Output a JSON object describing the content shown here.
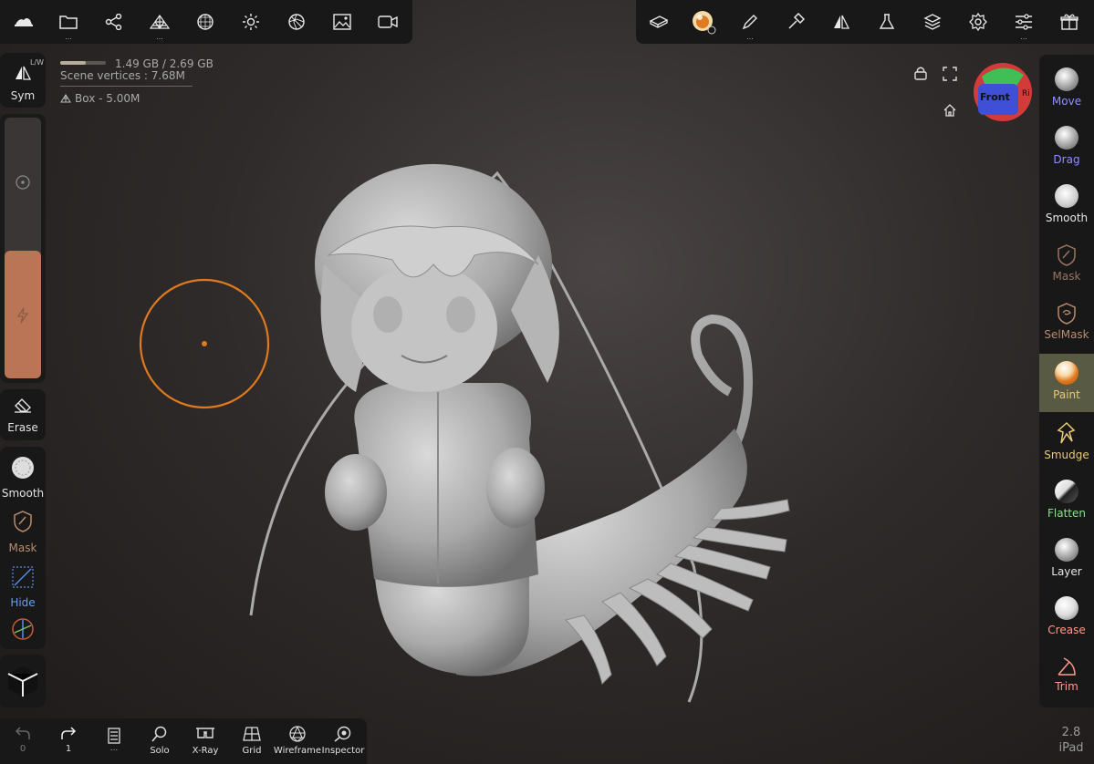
{
  "top_left_icons": [
    "hat-icon",
    "folder-icon",
    "scene-graph-icon",
    "topology-icon",
    "multires-icon",
    "light-icon",
    "shading-icon",
    "image-icon",
    "video-icon"
  ],
  "top_right_icons": [
    "box-eraser-icon",
    "paint-brush-material-icon",
    "pen-icon",
    "hammer-icon",
    "symmetry-icon",
    "flask-icon",
    "layers-icon",
    "settings-icon",
    "sliders-icon",
    "gift-icon"
  ],
  "stats": {
    "memory": "1.49 GB / 2.69 GB",
    "memory_fraction": 0.55,
    "vertices": "Scene vertices : 7.68M",
    "object": "Box - 5.00M"
  },
  "left": {
    "sym_label": "Sym",
    "lw_label": "L/W",
    "erase_label": "Erase",
    "smooth_label": "Smooth",
    "mask_label": "Mask",
    "hide_label": "Hide"
  },
  "gizmo": {
    "front": "Front",
    "right": "Ri"
  },
  "right_tools": [
    {
      "label": "Move",
      "color": "#8f8fff"
    },
    {
      "label": "Drag",
      "color": "#8f8fff"
    },
    {
      "label": "Smooth",
      "color": "#e6e6e6"
    },
    {
      "label": "Mask",
      "color": "#b88c6e"
    },
    {
      "label": "SelMask",
      "color": "#b88c6e"
    },
    {
      "label": "Paint",
      "color": "#e6c97a"
    },
    {
      "label": "Smudge",
      "color": "#e6c97a"
    },
    {
      "label": "Flatten",
      "color": "#8fe08f"
    },
    {
      "label": "Layer",
      "color": "#e6e6e6"
    },
    {
      "label": "Crease",
      "color": "#ff9a8a"
    },
    {
      "label": "Trim",
      "color": "#ff9a8a"
    }
  ],
  "bottom": {
    "undo_count": "0",
    "redo_count": "1",
    "more_label": "...",
    "solo": "Solo",
    "xray": "X-Ray",
    "grid": "Grid",
    "wireframe": "Wireframe",
    "inspector": "Inspector"
  },
  "version": {
    "number": "2.8",
    "device": "iPad"
  },
  "colors": {
    "accent_orange": "#e07a1e",
    "panel": "#191818",
    "brush_fill": "#b97556"
  }
}
